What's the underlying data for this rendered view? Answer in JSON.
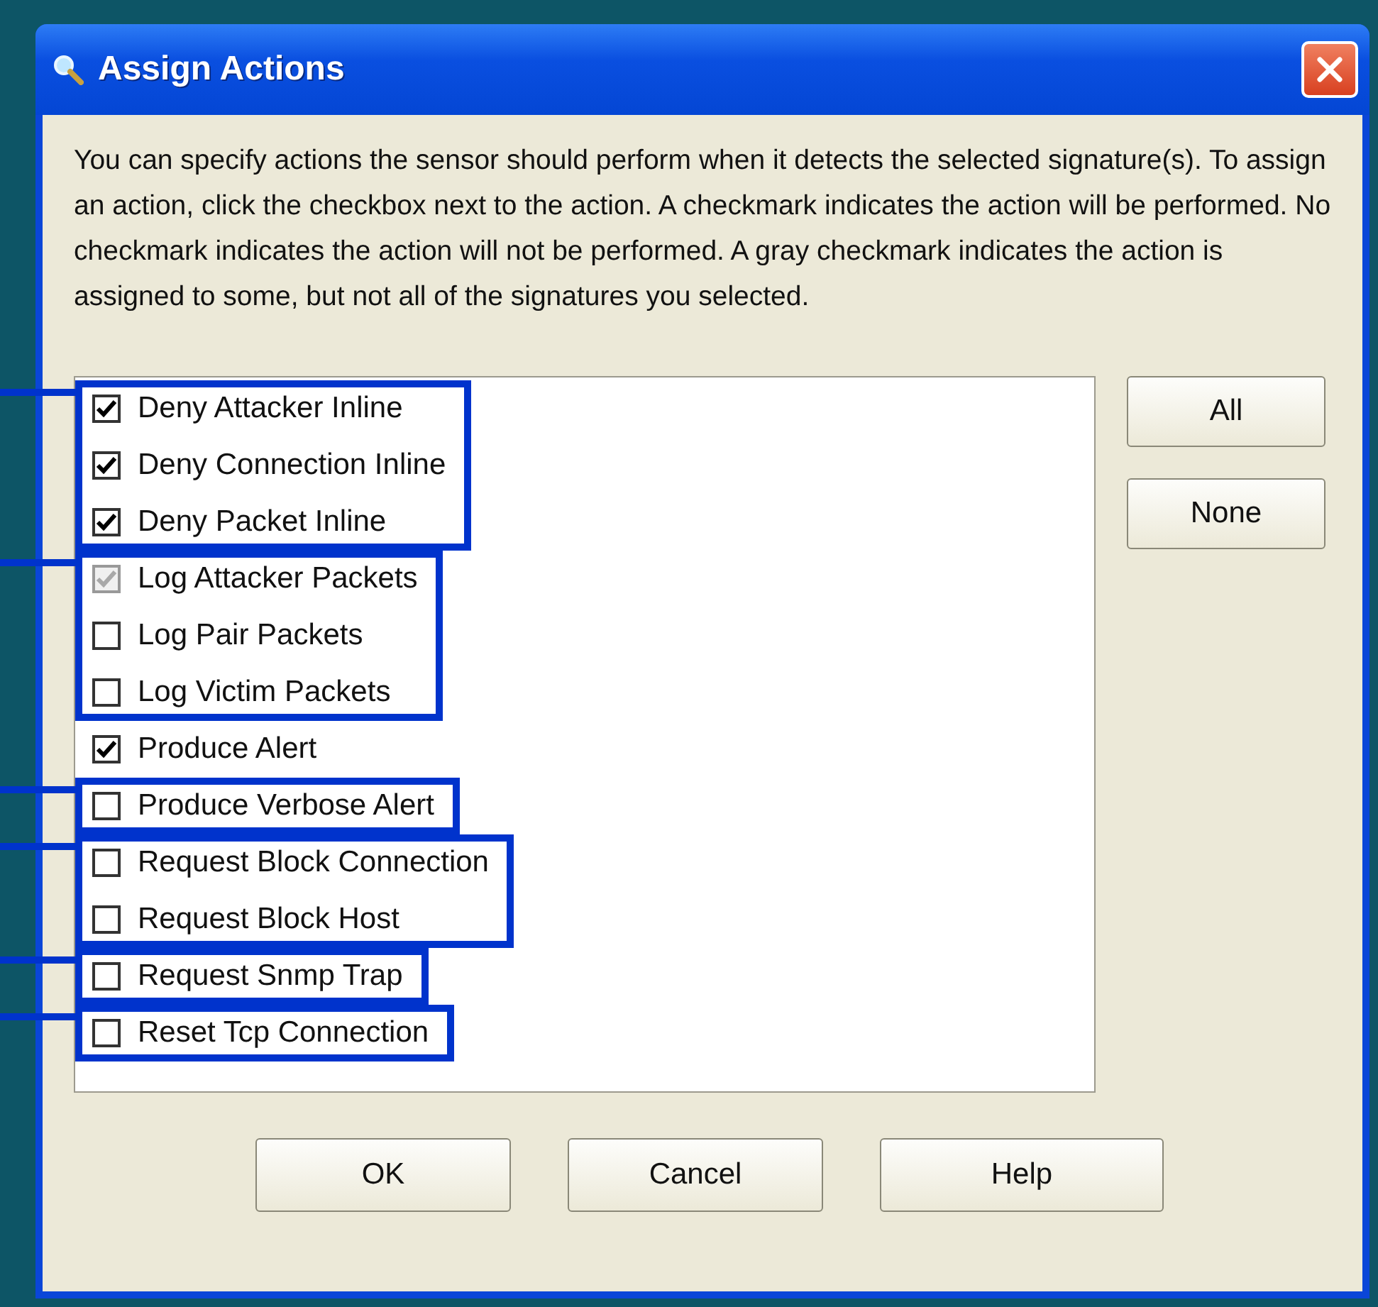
{
  "window": {
    "title": "Assign Actions"
  },
  "description": "You can specify actions the sensor should perform when it detects the selected signature(s). To assign an action, click the checkbox next to the action. A checkmark indicates the action will be performed. No checkmark indicates the action will not be performed. A gray checkmark indicates the action is assigned to some, but not all of the signatures you selected.",
  "action_groups": [
    {
      "highlighted": true,
      "actions": [
        {
          "label": "Deny Attacker Inline",
          "checked": true,
          "partial": false
        },
        {
          "label": "Deny Connection Inline",
          "checked": true,
          "partial": false
        },
        {
          "label": "Deny Packet Inline",
          "checked": true,
          "partial": false
        }
      ]
    },
    {
      "highlighted": true,
      "actions": [
        {
          "label": "Log Attacker Packets",
          "checked": true,
          "partial": true
        },
        {
          "label": "Log Pair Packets",
          "checked": false,
          "partial": false
        },
        {
          "label": "Log Victim Packets",
          "checked": false,
          "partial": false
        }
      ]
    },
    {
      "highlighted": false,
      "actions": [
        {
          "label": "Produce Alert",
          "checked": true,
          "partial": false
        }
      ]
    },
    {
      "highlighted": true,
      "actions": [
        {
          "label": "Produce Verbose Alert",
          "checked": false,
          "partial": false
        }
      ]
    },
    {
      "highlighted": true,
      "actions": [
        {
          "label": "Request Block Connection",
          "checked": false,
          "partial": false
        },
        {
          "label": "Request Block Host",
          "checked": false,
          "partial": false
        }
      ]
    },
    {
      "highlighted": true,
      "actions": [
        {
          "label": "Request Snmp Trap",
          "checked": false,
          "partial": false
        }
      ]
    },
    {
      "highlighted": true,
      "actions": [
        {
          "label": "Reset Tcp Connection",
          "checked": false,
          "partial": false
        }
      ]
    }
  ],
  "side_buttons": [
    "All",
    "None"
  ],
  "buttons": [
    "OK",
    "Cancel",
    "Help"
  ]
}
